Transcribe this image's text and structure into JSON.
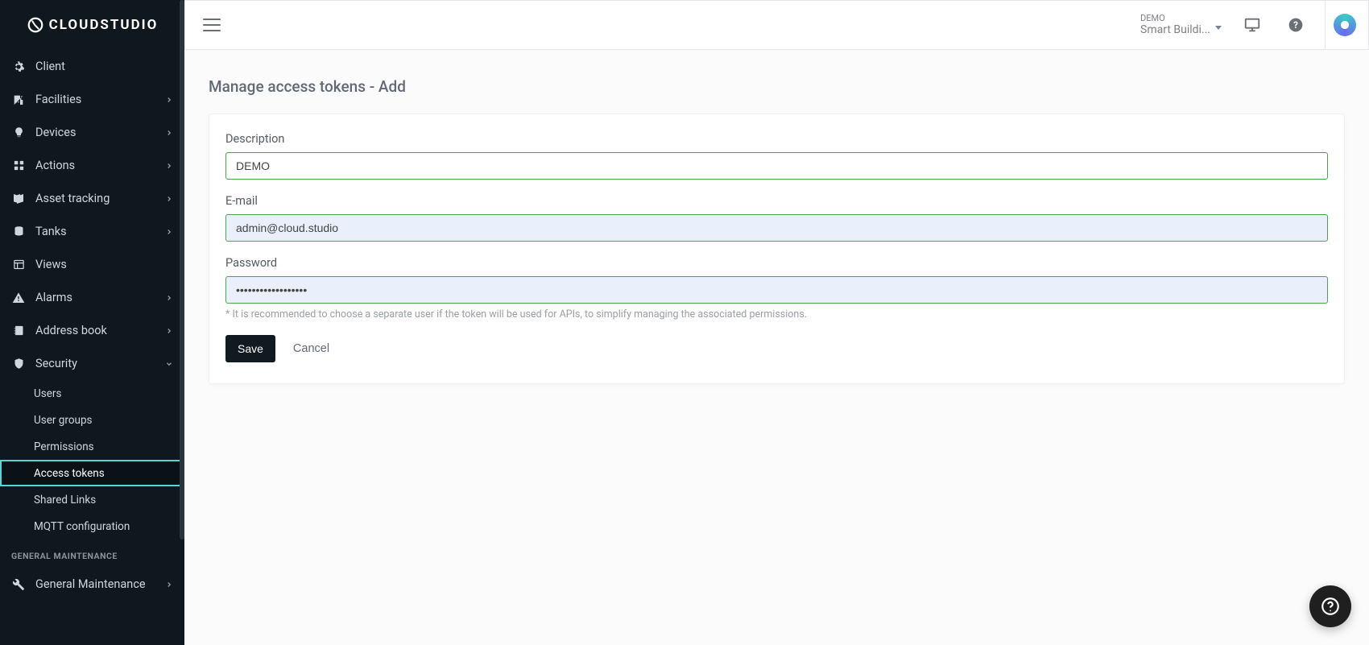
{
  "brand": "CLOUDSTUDIO",
  "sidebar": {
    "items": [
      {
        "label": "Client",
        "icon": "gear-icon",
        "expandable": false
      },
      {
        "label": "Facilities",
        "icon": "building-icon",
        "expandable": true
      },
      {
        "label": "Devices",
        "icon": "bulb-icon",
        "expandable": true
      },
      {
        "label": "Actions",
        "icon": "grid-icon",
        "expandable": true
      },
      {
        "label": "Asset tracking",
        "icon": "map-icon",
        "expandable": true
      },
      {
        "label": "Tanks",
        "icon": "database-icon",
        "expandable": true
      },
      {
        "label": "Views",
        "icon": "layout-icon",
        "expandable": false
      },
      {
        "label": "Alarms",
        "icon": "alert-icon",
        "expandable": true
      },
      {
        "label": "Address book",
        "icon": "contacts-icon",
        "expandable": true
      },
      {
        "label": "Security",
        "icon": "shield-icon",
        "expandable": true,
        "expanded": true
      }
    ],
    "security_subitems": [
      {
        "label": "Users"
      },
      {
        "label": "User groups"
      },
      {
        "label": "Permissions"
      },
      {
        "label": "Access tokens",
        "active": true
      },
      {
        "label": "Shared Links"
      },
      {
        "label": "MQTT configuration"
      }
    ],
    "section_label": "GENERAL MAINTENANCE",
    "general_maintenance": {
      "label": "General Maintenance",
      "icon": "wrench-icon",
      "expandable": true
    }
  },
  "topbar": {
    "tenant_top": "DEMO",
    "tenant_bottom": "Smart Buildi..."
  },
  "page": {
    "title": "Manage access tokens - Add",
    "form": {
      "description_label": "Description",
      "description_value": "DEMO",
      "email_label": "E-mail",
      "email_value": "admin@cloud.studio",
      "password_label": "Password",
      "password_value": "••••••••••••••••••",
      "helper_text": "* It is recommended to choose a separate user if the token will be used for APIs, to simplify managing the associated permissions.",
      "save_label": "Save",
      "cancel_label": "Cancel"
    }
  }
}
